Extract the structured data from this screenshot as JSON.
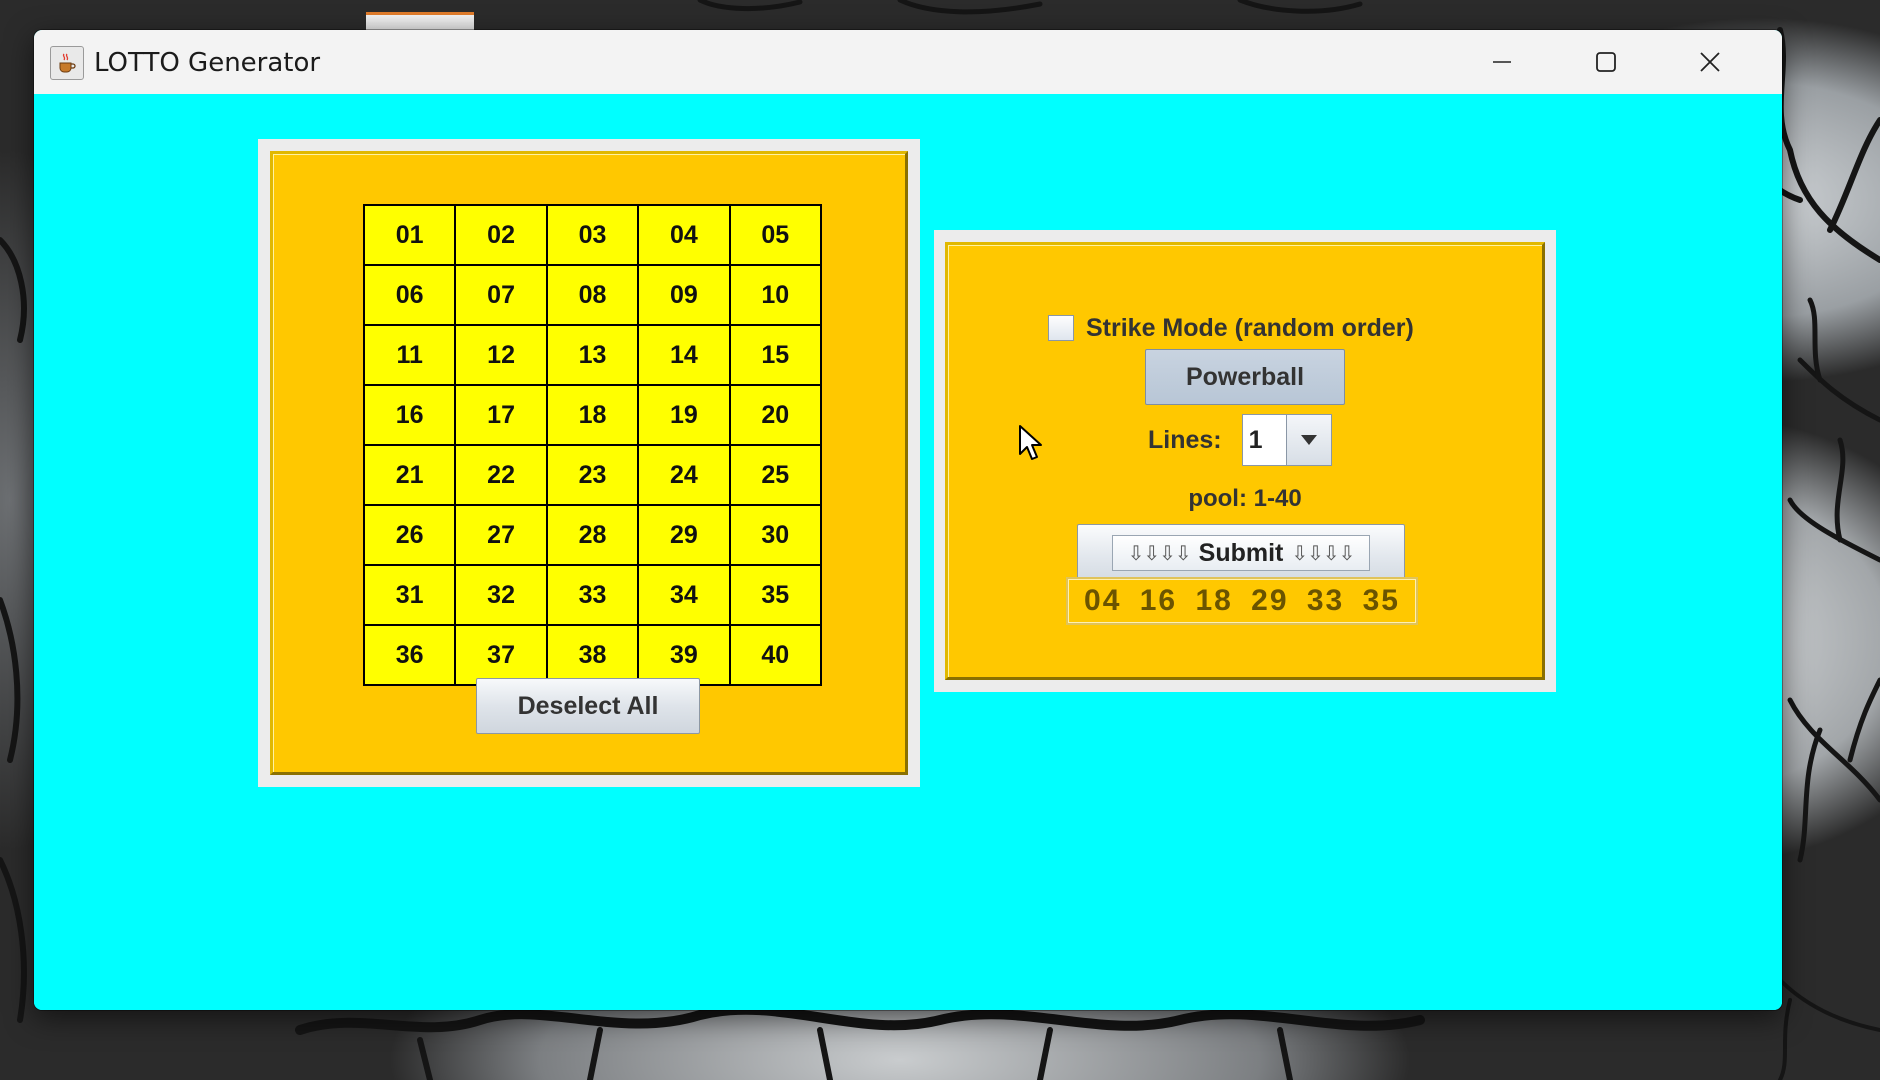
{
  "window": {
    "title": "LOTTO Generator"
  },
  "grid": {
    "numbers": [
      "01",
      "02",
      "03",
      "04",
      "05",
      "06",
      "07",
      "08",
      "09",
      "10",
      "11",
      "12",
      "13",
      "14",
      "15",
      "16",
      "17",
      "18",
      "19",
      "20",
      "21",
      "22",
      "23",
      "24",
      "25",
      "26",
      "27",
      "28",
      "29",
      "30",
      "31",
      "32",
      "33",
      "34",
      "35",
      "36",
      "37",
      "38",
      "39",
      "40"
    ]
  },
  "left_panel": {
    "deselect_label": "Deselect All"
  },
  "right_panel": {
    "strike_mode_label": "Strike Mode (random order)",
    "strike_mode_checked": false,
    "powerball_label": "Powerball",
    "lines_label": "Lines:",
    "lines_value": "1",
    "pool_label": "pool: 1-40",
    "submit_label": "Submit",
    "submit_arrows_left": "⇩⇩⇩⇩",
    "submit_arrows_right": "⇩⇩⇩⇩",
    "result": "04 16 18 29 33 35"
  },
  "colors": {
    "client_bg": "#00ffff",
    "panel_bg": "#ffc800",
    "cell_bg": "#ffff00"
  },
  "icons": {
    "app": "java-coffee-icon",
    "minimize": "minimize-icon",
    "maximize": "maximize-icon",
    "close": "close-icon",
    "combo": "chevron-down-icon"
  }
}
